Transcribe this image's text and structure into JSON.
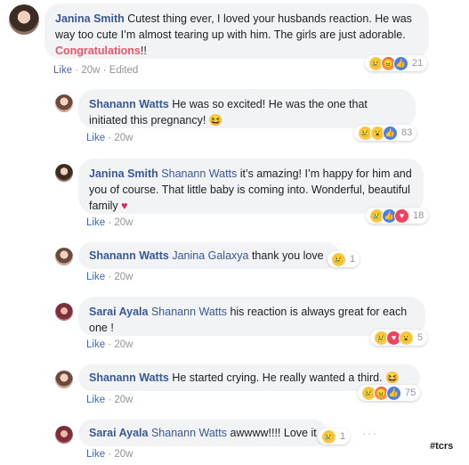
{
  "comments": [
    {
      "author": "Janina Smith",
      "text_a": "Cutest thing ever, I loved your husbands reaction. He was way too cute I’m almost tearing up with him. The girls are just adorable. ",
      "highlight": "Congratulations",
      "text_b": "!!",
      "like": "Like",
      "time": "20w",
      "edited": "Edited",
      "reactions": [
        "sad-icon",
        "angry-icon",
        "like-icon"
      ],
      "count": "21"
    },
    {
      "author": "Shanann Watts",
      "text": "He was so excited! He was the one that initiated this pregnancy! 😆",
      "like": "Like",
      "time": "20w",
      "reactions": [
        "sad-icon",
        "wow-icon",
        "like-icon"
      ],
      "count": "83"
    },
    {
      "author": "Janina Smith",
      "mention": "Shanann Watts",
      "text": " it’s amazing! I’m happy for him and you of course. That little baby is coming into. Wonderful, beautiful family ",
      "emoji": "♥",
      "like": "Like",
      "time": "20w",
      "reactions": [
        "sad-icon",
        "like-icon",
        "love-icon"
      ],
      "count": "18"
    },
    {
      "author": "Shanann Watts",
      "mention": "Janina Galaxya",
      "text": " thank you love",
      "like": "Like",
      "time": "20w",
      "reactions": [
        "sad-icon"
      ],
      "count": "1"
    },
    {
      "author": "Sarai Ayala",
      "mention": "Shanann Watts",
      "text": " his reaction is always great for each one !",
      "like": "Like",
      "time": "20w",
      "reactions": [
        "sad-icon",
        "love-icon",
        "wow-icon"
      ],
      "count": "5"
    },
    {
      "author": "Shanann Watts",
      "text": "He started crying. He really wanted a third. 😆",
      "like": "Like",
      "time": "20w",
      "reactions": [
        "sad-icon",
        "angry-icon",
        "like-icon"
      ],
      "count": "75"
    },
    {
      "author": "Sarai Ayala",
      "mention": "Shanann Watts",
      "text": " awwww!!!! Love it",
      "like": "Like",
      "time": "20w",
      "reactions": [
        "sad-icon"
      ],
      "count": "1"
    }
  ],
  "more_options": "···",
  "hashtag": "#tcrs",
  "dot": "·",
  "colors": {
    "name": "#385898",
    "like": "#4267b2",
    "bubble": "#f2f3f5",
    "meta": "#90949c"
  }
}
